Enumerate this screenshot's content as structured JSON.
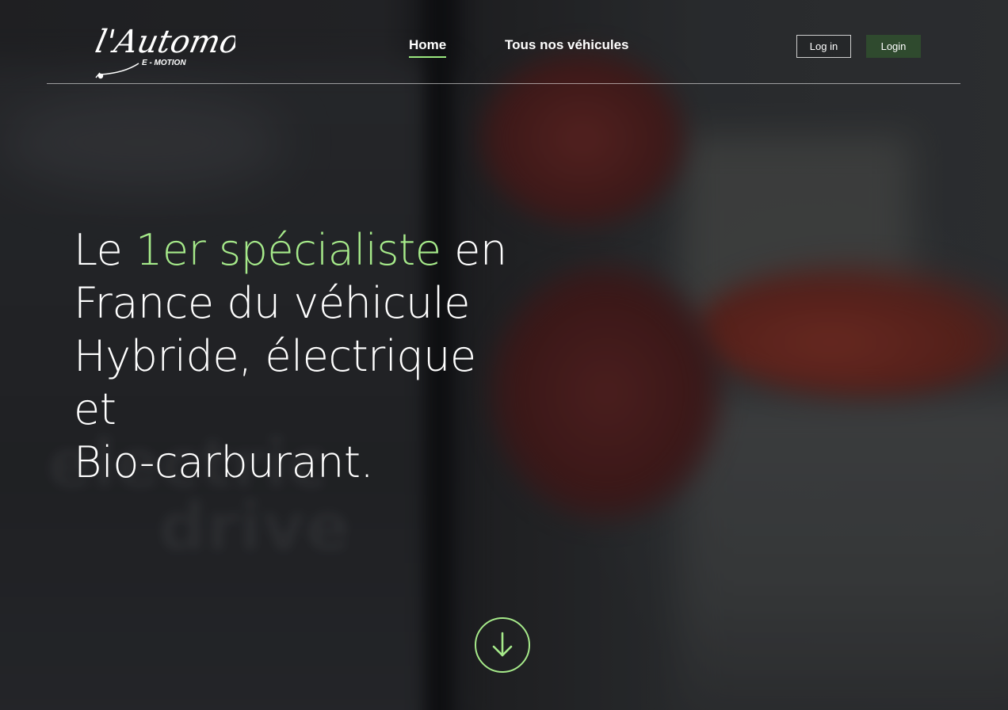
{
  "brand": {
    "logo_script": "l'Automobile",
    "logo_tagline": "E - MOTION"
  },
  "nav": {
    "items": [
      {
        "label": "Home",
        "active": true
      },
      {
        "label": "Tous nos véhicules",
        "active": false
      }
    ]
  },
  "auth": {
    "login_outline_label": "Log in",
    "login_solid_label": "Login"
  },
  "hero": {
    "headline_prefix": "Le ",
    "headline_accent": "1er spécialiste",
    "headline_line1_suffix": " en",
    "headline_line2": "France du véhicule",
    "headline_line3": "Hybride, électrique et",
    "headline_line4": "Bio-carburant.",
    "background_text_line1": "electric",
    "background_text_line2": "drive"
  },
  "scroll_button": {
    "icon": "arrow-down-icon"
  },
  "colors": {
    "accent": "#a6ea8a",
    "nav_underline": "#9be87f",
    "login_button_bg": "#2f4a2e",
    "text": "#ffffff"
  }
}
